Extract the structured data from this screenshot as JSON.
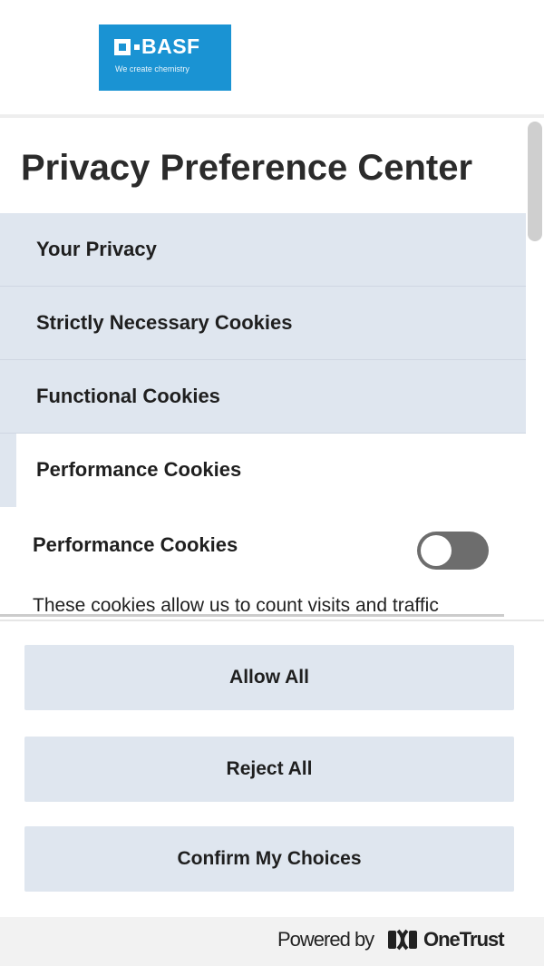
{
  "brand": {
    "logo_text": "BASF",
    "tagline": "We create chemistry",
    "accent_color": "#1a93d3"
  },
  "title": "Privacy Preference Center",
  "menu": {
    "items": [
      {
        "label": "Your Privacy",
        "active": false
      },
      {
        "label": "Strictly Necessary Cookies",
        "active": false
      },
      {
        "label": "Functional Cookies",
        "active": false
      },
      {
        "label": "Performance Cookies",
        "active": true
      }
    ]
  },
  "detail": {
    "title": "Performance Cookies",
    "toggle_on": false,
    "description": "These cookies allow us to count visits and traffic"
  },
  "buttons": {
    "allow_all": "Allow All",
    "reject_all": "Reject All",
    "confirm": "Confirm My Choices"
  },
  "footer": {
    "powered_by": "Powered by",
    "vendor": "OneTrust",
    "vendor_icon": "onetrust-logo-icon"
  },
  "colors": {
    "menu_bg": "#dfe6ef",
    "button_bg": "#dfe6ef",
    "toggle_off": "#6d6d6d"
  }
}
